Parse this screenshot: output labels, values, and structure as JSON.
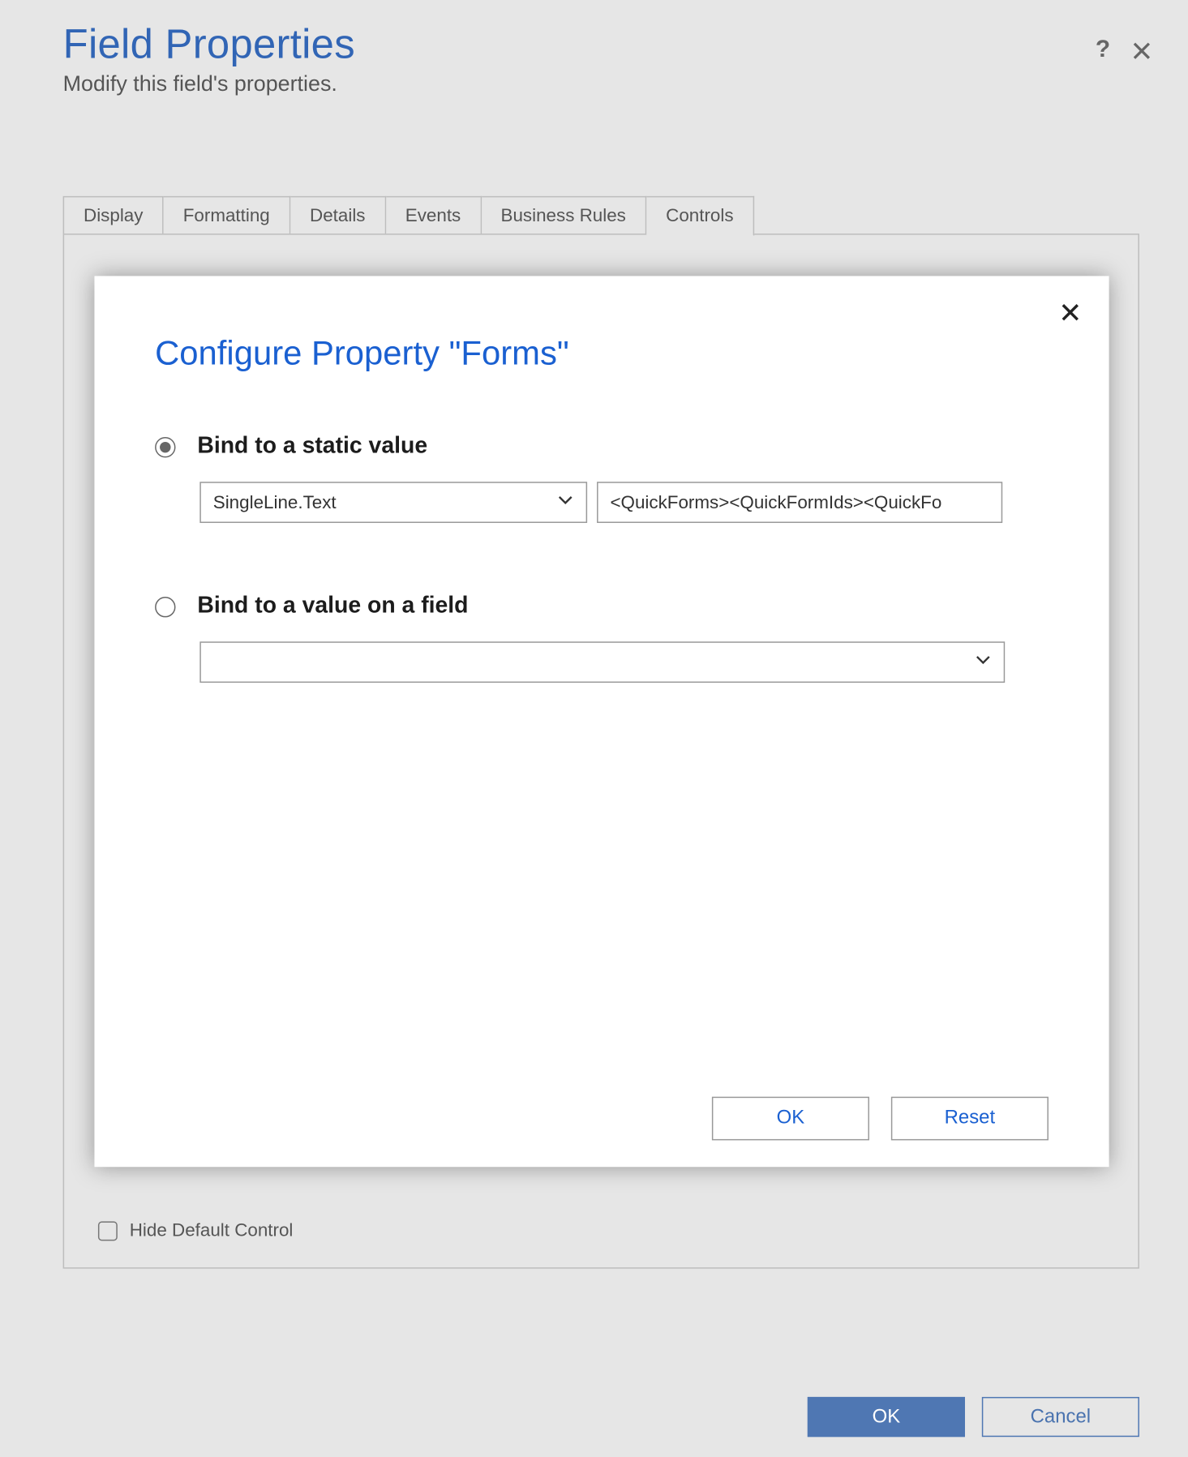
{
  "dialog": {
    "title": "Field Properties",
    "subtitle": "Modify this field's properties.",
    "tabs": [
      "Display",
      "Formatting",
      "Details",
      "Events",
      "Business Rules",
      "Controls"
    ],
    "active_tab_index": 5,
    "hide_default_label": "Hide Default Control",
    "ok_label": "OK",
    "cancel_label": "Cancel"
  },
  "modal": {
    "title": "Configure Property \"Forms\"",
    "option_static": {
      "label": "Bind to a static value",
      "checked": true,
      "type_select_value": "SingleLine.Text",
      "value_input": "<QuickForms><QuickFormIds><QuickFo"
    },
    "option_field": {
      "label": "Bind to a value on a field",
      "checked": false,
      "select_value": ""
    },
    "ok_label": "OK",
    "reset_label": "Reset"
  }
}
